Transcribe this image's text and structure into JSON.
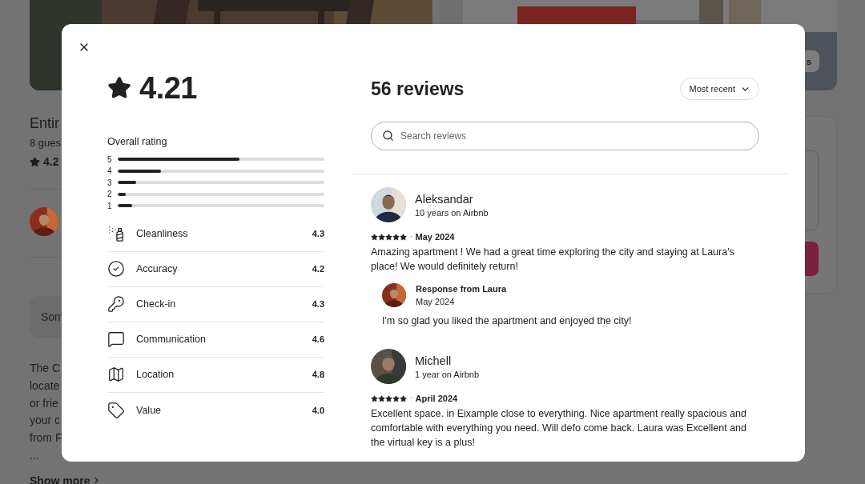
{
  "listing": {
    "photo_button": "s",
    "title": "Entir",
    "subtitle": "8 gues",
    "rating": "4.2",
    "host_note": "Som",
    "description_lines": [
      "The C",
      "locate",
      "or frie",
      "your c",
      "from F",
      "..."
    ],
    "show_more": "Show more"
  },
  "modal": {
    "rating": {
      "score": "4.21",
      "overall_label": "Overall rating",
      "distribution": [
        {
          "label": "5",
          "level": 0.59
        },
        {
          "label": "4",
          "level": 0.21
        },
        {
          "label": "3",
          "level": 0.09
        },
        {
          "label": "2",
          "level": 0.04
        },
        {
          "label": "1",
          "level": 0.07
        }
      ],
      "categories": [
        {
          "kind": "cleanliness",
          "label": "Cleanliness",
          "value": "4.3"
        },
        {
          "kind": "accuracy",
          "label": "Accuracy",
          "value": "4.2"
        },
        {
          "kind": "checkin",
          "label": "Check-in",
          "value": "4.3"
        },
        {
          "kind": "communication",
          "label": "Communication",
          "value": "4.6"
        },
        {
          "kind": "location",
          "label": "Location",
          "value": "4.8"
        },
        {
          "kind": "value",
          "label": "Value",
          "value": "4.0"
        }
      ]
    },
    "reviews_header": {
      "title": "56 reviews",
      "sort": "Most recent",
      "search_placeholder": "Search reviews"
    },
    "reviews": [
      {
        "name": "Aleksandar",
        "tenure": "10 years on Airbnb",
        "stars": 5,
        "separator": "·",
        "date": "May 2024",
        "text": "Amazing apartment ! We had a great time exploring the city and staying at Laura's place! We would definitely return!",
        "response": {
          "title": "Response from Laura",
          "date": "May 2024",
          "text": "I'm so glad you liked the apartment and enjoyed the city!"
        }
      },
      {
        "name": "Michell",
        "tenure": "1 year on Airbnb",
        "stars": 5,
        "separator": "·",
        "date": "April 2024",
        "text": "Excellent space. in Eixample close to everything. Nice apartment really spacious and comfortable with everything you need. Will defo come back. Laura was Excellent and the virtual key is a plus!"
      }
    ]
  }
}
